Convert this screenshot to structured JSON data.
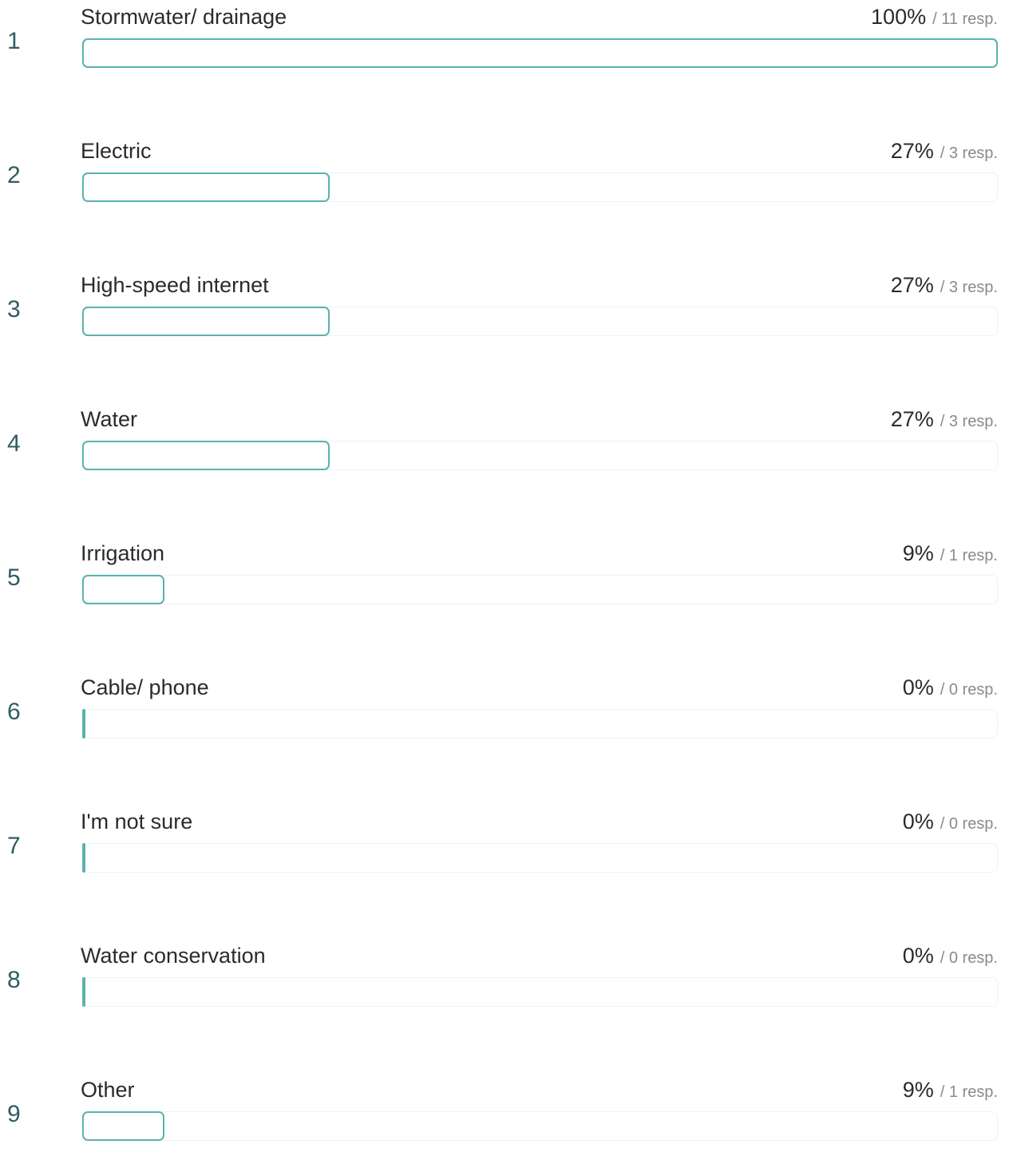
{
  "results": [
    {
      "rank": "1",
      "label": "Stormwater/ drainage",
      "percent_text": "100%",
      "responses_text": "/ 11 resp.",
      "percent": 100
    },
    {
      "rank": "2",
      "label": "Electric",
      "percent_text": "27%",
      "responses_text": "/ 3 resp.",
      "percent": 27
    },
    {
      "rank": "3",
      "label": "High-speed internet",
      "percent_text": "27%",
      "responses_text": "/ 3 resp.",
      "percent": 27
    },
    {
      "rank": "4",
      "label": "Water",
      "percent_text": "27%",
      "responses_text": "/ 3 resp.",
      "percent": 27
    },
    {
      "rank": "5",
      "label": "Irrigation",
      "percent_text": "9%",
      "responses_text": "/ 1 resp.",
      "percent": 9
    },
    {
      "rank": "6",
      "label": "Cable/ phone",
      "percent_text": "0%",
      "responses_text": "/ 0 resp.",
      "percent": 0
    },
    {
      "rank": "7",
      "label": "I'm not sure",
      "percent_text": "0%",
      "responses_text": "/ 0 resp.",
      "percent": 0
    },
    {
      "rank": "8",
      "label": "Water conservation",
      "percent_text": "0%",
      "responses_text": "/ 0 resp.",
      "percent": 0
    },
    {
      "rank": "9",
      "label": "Other",
      "percent_text": "9%",
      "responses_text": "/ 1 resp.",
      "percent": 9
    }
  ],
  "colors": {
    "bar_border": "#5bb2ad",
    "rank_text": "#2f5d62",
    "track_border": "#eef3f3"
  }
}
